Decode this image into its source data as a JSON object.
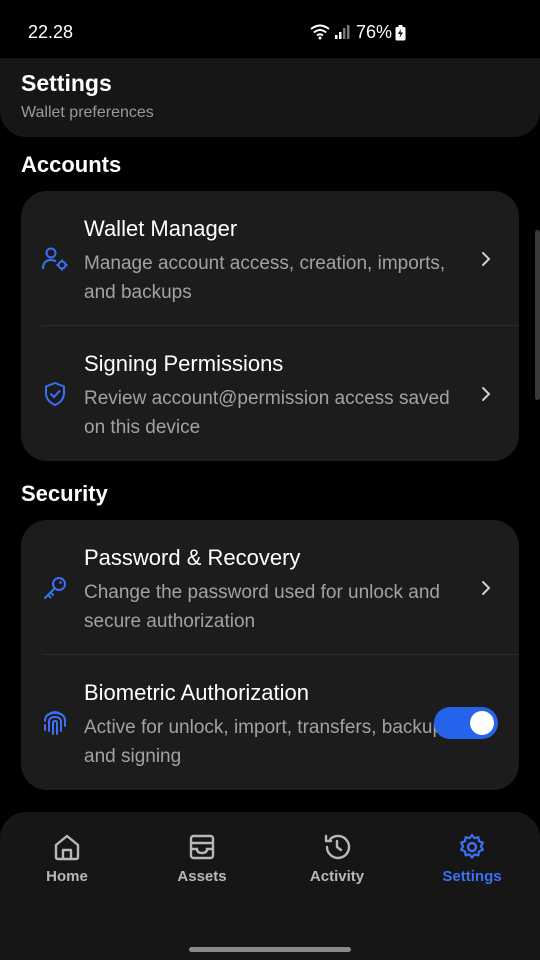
{
  "status": {
    "time": "22.28",
    "battery": "76%"
  },
  "header": {
    "title": "Settings",
    "subtitle": "Wallet preferences"
  },
  "sections": {
    "accounts": {
      "title": "Accounts",
      "items": [
        {
          "title": "Wallet Manager",
          "description": "Manage account access, creation, imports, and backups",
          "icon": "user-gear-icon"
        },
        {
          "title": "Signing Permissions",
          "description": "Review account@permission access saved on this device",
          "icon": "shield-check-icon"
        }
      ]
    },
    "security": {
      "title": "Security",
      "items": [
        {
          "title": "Password & Recovery",
          "description": "Change the password used for unlock and secure authorization",
          "icon": "key-icon"
        },
        {
          "title": "Biometric Authorization",
          "description": "Active for unlock, import, transfers, backup, and signing",
          "icon": "fingerprint-icon",
          "toggle_on": true
        }
      ]
    }
  },
  "nav": {
    "items": [
      {
        "label": "Home",
        "icon": "home-icon"
      },
      {
        "label": "Assets",
        "icon": "archive-icon"
      },
      {
        "label": "Activity",
        "icon": "history-icon"
      },
      {
        "label": "Settings",
        "icon": "gear-icon",
        "active": true
      }
    ]
  },
  "colors": {
    "accent": "#2563eb",
    "card": "#1c1c1c",
    "background": "#000000"
  }
}
